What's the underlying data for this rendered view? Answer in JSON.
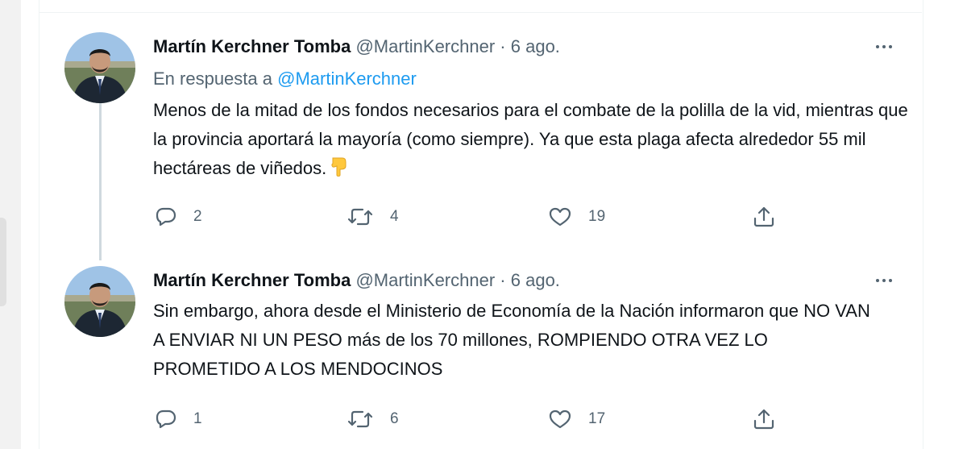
{
  "tweets": [
    {
      "author_name": "Martín Kerchner Tomba",
      "handle": "@MartinKerchner",
      "separator": "·",
      "date": "6 ago.",
      "reply_prefix": "En respuesta a",
      "reply_mention": "@MartinKerchner",
      "text": "Menos de la mitad de los fondos necesarios para el combate de la polilla de la vid, mientras que la provincia aportará la mayoría (como siempre). Ya que esta plaga afecta alrededor 55 mil hectáreas de viñedos.",
      "emoji": "backhand-index-pointing-down",
      "replies": "2",
      "retweets": "4",
      "likes": "19"
    },
    {
      "author_name": "Martín Kerchner Tomba",
      "handle": "@MartinKerchner",
      "separator": "·",
      "date": "6 ago.",
      "text": "Sin embargo, ahora desde el Ministerio de Economía de la Nación informaron que NO VAN A ENVIAR NI UN PESO más de los 70 millones, ROMPIENDO OTRA VEZ LO PROMETIDO A LOS MENDOCINOS",
      "replies": "1",
      "retweets": "6",
      "likes": "17"
    }
  ],
  "icons": {
    "reply": "reply-icon",
    "retweet": "retweet-icon",
    "like": "like-icon",
    "share": "share-icon",
    "more": "more-icon"
  },
  "colors": {
    "text": "#0f1419",
    "secondary": "#536471",
    "link": "#1d9bf0",
    "thread_line": "#cfd9de"
  }
}
